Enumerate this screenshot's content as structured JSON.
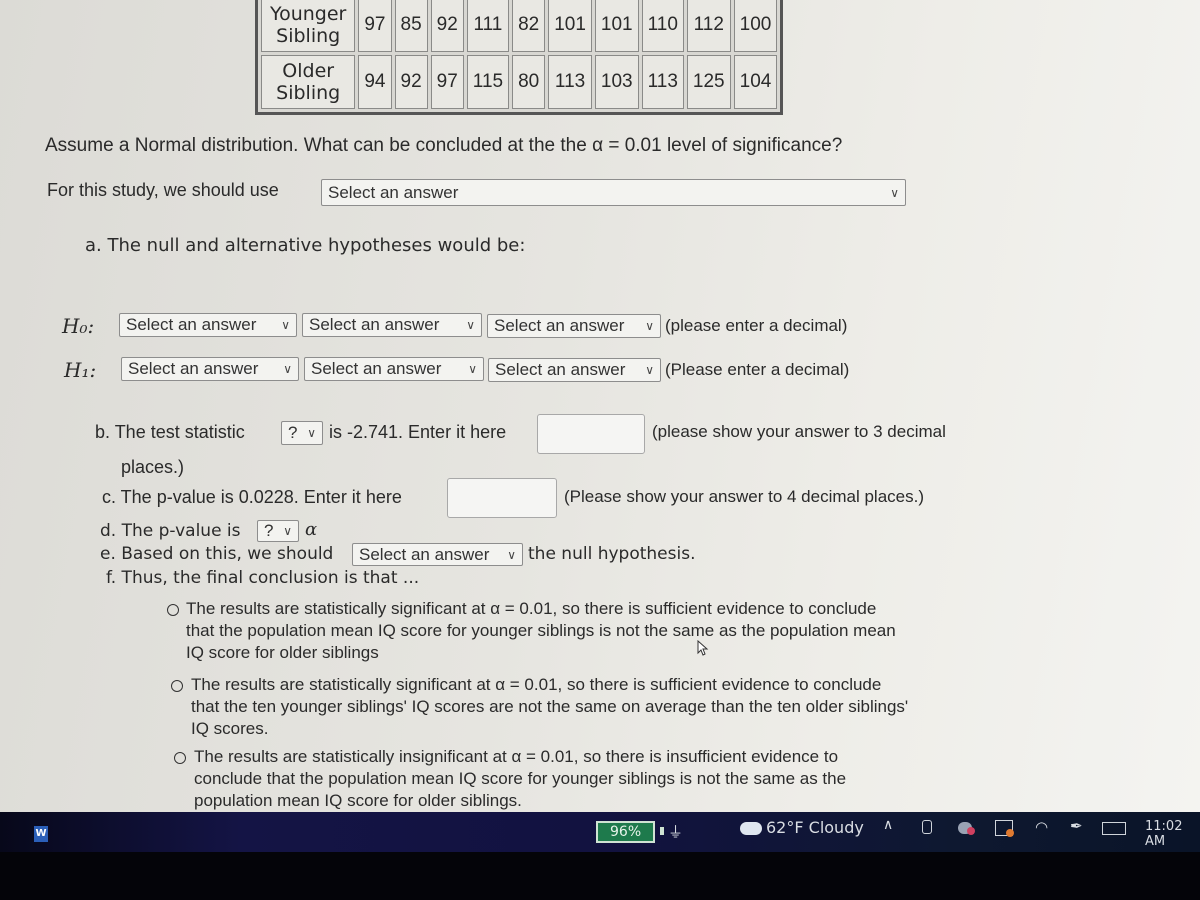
{
  "table": {
    "rows": [
      {
        "label_line1": "Younger",
        "label_line2": "Sibling",
        "values": [
          "97",
          "85",
          "92",
          "111",
          "82",
          "101",
          "101",
          "110",
          "112",
          "100"
        ]
      },
      {
        "label_line1": "Older",
        "label_line2": "Sibling",
        "values": [
          "94",
          "92",
          "97",
          "115",
          "80",
          "113",
          "103",
          "113",
          "125",
          "104"
        ]
      }
    ]
  },
  "question": {
    "prompt": "Assume a Normal distribution.  What can be concluded at the the α = 0.01 level of significance?",
    "study_label": "For this study, we should use",
    "study_select": "Select an answer"
  },
  "part_a": {
    "label": "a. The null and alternative hypotheses would be:",
    "h0": {
      "symbol": "H₀:",
      "selects": [
        "Select an answer",
        "Select an answer",
        "Select an answer"
      ],
      "note": "(please enter a decimal)"
    },
    "h1": {
      "symbol": "H₁:",
      "selects": [
        "Select an answer",
        "Select an answer",
        "Select an answer"
      ],
      "note": "(Please enter a decimal)"
    }
  },
  "part_b": {
    "prefix": "b. The test statistic",
    "select": "?",
    "middle": "is -2.741. Enter it here",
    "input_value": "",
    "note": "(please show your answer to 3 decimal",
    "note2": "places.)"
  },
  "part_c": {
    "prefix": "c. The p-value is 0.0228. Enter it here",
    "input_value": "",
    "note": "(Please show your answer to 4 decimal places.)"
  },
  "part_d": {
    "prefix": "d. The p-value is",
    "select": "?",
    "suffix": "α"
  },
  "part_e": {
    "prefix": "e. Based on this, we should",
    "select": "Select an answer",
    "suffix": "the null hypothesis."
  },
  "part_f": {
    "label": "f. Thus, the final conclusion is that ...",
    "options": [
      {
        "lines": [
          "The results are statistically significant at α = 0.01, so there is sufficient evidence to conclude",
          "that the population mean IQ score for younger siblings is not the same as the population mean",
          "IQ score for older siblings"
        ]
      },
      {
        "lines": [
          "The results are statistically significant at α = 0.01, so there is sufficient evidence to conclude",
          "that the ten younger siblings' IQ scores are not the same on average than the ten older siblings'",
          "IQ scores."
        ]
      },
      {
        "lines": [
          "The results are statistically insignificant at α = 0.01, so there is insufficient evidence to",
          "conclude that the population mean IQ score for younger siblings is not the same as the",
          "population mean IQ score for older siblings."
        ]
      }
    ]
  },
  "taskbar": {
    "app_icon": "W",
    "battery": "96%",
    "weather": "62°F  Cloudy",
    "time": "11:02 AM",
    "colors": {
      "battery_fill": "#1e7a4c",
      "word_icon": "#2b5fb8"
    }
  }
}
